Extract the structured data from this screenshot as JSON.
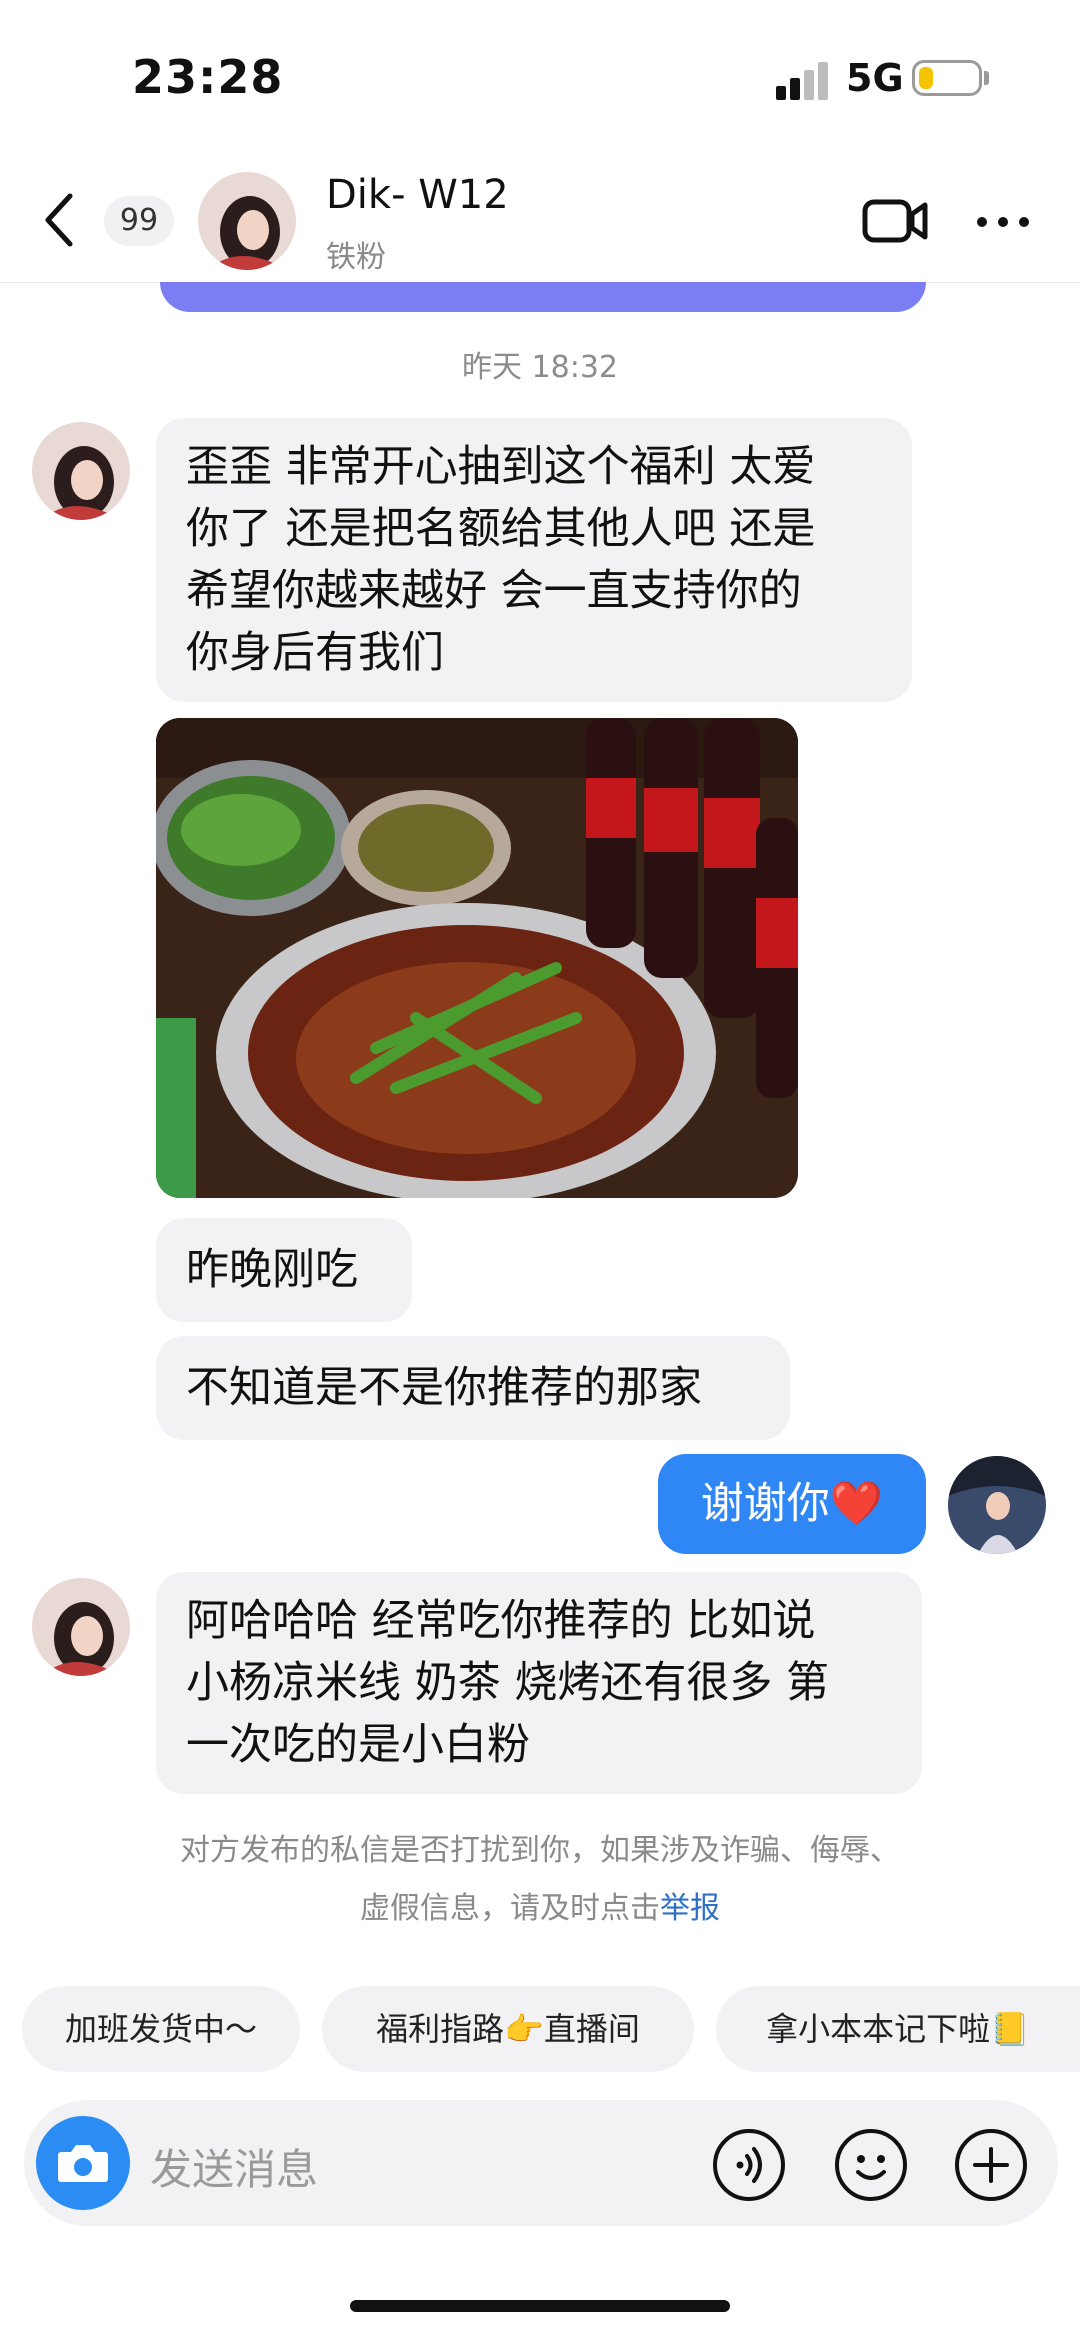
{
  "status": {
    "time": "23:28",
    "network": "5G",
    "battery_level": 0.25
  },
  "header": {
    "unread_count": "99",
    "contact_name": "Dik- W12",
    "contact_tag": "铁粉"
  },
  "chat": {
    "timestamp": "昨天 18:32",
    "messages": [
      {
        "lines": [
          "歪歪 非常开心抽到这个福利 太爱",
          "你了 还是把名额给其他人吧 还是",
          "希望你越来越好 会一直支持你的",
          "你身后有我们"
        ]
      },
      {
        "text": "昨晚刚吃"
      },
      {
        "text": "不知道是不是你推荐的那家"
      },
      {
        "text": "谢谢你❤️"
      },
      {
        "lines": [
          "阿哈哈哈 经常吃你推荐的 比如说",
          "小杨凉米线 奶茶 烧烤还有很多 第",
          "一次吃的是小白粉"
        ]
      }
    ]
  },
  "notice": {
    "line1": "对方发布的私信是否打扰到你，如果涉及诈骗、侮辱、",
    "line2_prefix": "虚假信息，请及时点击",
    "report_link": "举报"
  },
  "quick_replies": [
    "加班发货中～",
    "福利指路👉直播间",
    "拿小本本记下啦📒"
  ],
  "composer": {
    "placeholder": "发送消息"
  },
  "colors": {
    "accent_blue": "#2f87f5",
    "purple_banner": "#7b7ef2",
    "bubble_gray": "#f2f2f4"
  }
}
